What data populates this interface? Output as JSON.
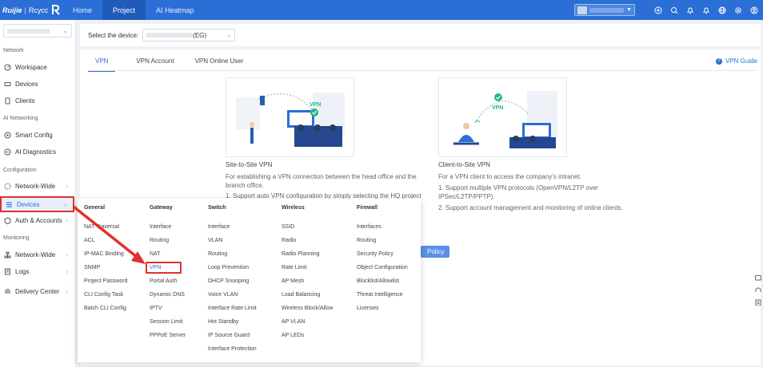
{
  "header": {
    "brand": "Ruijie",
    "brand_sub": "Rcycc",
    "nav": [
      "Home",
      "Project",
      "AI Heatmap"
    ],
    "active_nav": "Project"
  },
  "sidebar": {
    "sections": [
      {
        "title": "Network",
        "items": [
          "Workspace",
          "Devices",
          "Clients"
        ]
      },
      {
        "title": "AI Networking",
        "items": [
          "Smart Config",
          "AI Diagnostics"
        ]
      },
      {
        "title": "Configuration",
        "items": [
          "Network-Wide",
          "Devices",
          "Auth & Accounts"
        ]
      },
      {
        "title": "Monitoring",
        "items": [
          "Network-Wide",
          "Logs",
          "Delivery Center"
        ]
      }
    ]
  },
  "device_bar": {
    "label": "Select the device:",
    "selected_suffix": "(EG)"
  },
  "tabs": [
    "VPN",
    "VPN Account",
    "VPN Online User"
  ],
  "guide": "VPN Guide",
  "cards": {
    "s2s": {
      "title": "Site-to-Site VPN",
      "desc1": "For establishing a VPN connection between the head office and the",
      "desc2": "branch office.",
      "note": "1. Support auto VPN configuration by simply selecting the HQ project",
      "badge": "VPN"
    },
    "c2s": {
      "title": "Client-to-Site VPN",
      "desc1": "For a VPN client to access the company's intranet.",
      "note1": "1. Support multiple VPN protocols (OpenVPN/L2TP over",
      "note1b": "IPSec/L2TP/PPTP).",
      "note2": "2. Support account management and monitoring of online clients.",
      "badge": "VPN"
    }
  },
  "policy_button": "Policy",
  "menu": {
    "columns": [
      {
        "title": "General",
        "items": [
          "NAT Traversal",
          "ACL",
          "IP-MAC Binding",
          "SNMP",
          "Project Password",
          "CLI Config Task",
          "Batch CLI Config"
        ]
      },
      {
        "title": "Gateway",
        "items": [
          "Interface",
          "Routing",
          "NAT",
          "VPN",
          "Portal Auth",
          "Dynamic DNS",
          "IPTV",
          "Session Limit",
          "PPPoE Server"
        ]
      },
      {
        "title": "Switch",
        "items": [
          "Interface",
          "VLAN",
          "Routing",
          "Loop Prevention",
          "DHCP Snooping",
          "Voice VLAN",
          "Interface Rate Limit",
          "Hot Standby",
          "IP Source Guard",
          "Interface Protection"
        ]
      },
      {
        "title": "Wireless",
        "items": [
          "SSID",
          "Radio",
          "Radio Planning",
          "Rate Limit",
          "AP Mesh",
          "Load Balancing",
          "Wireless Block/Allow",
          "AP VLAN",
          "AP LEDs"
        ]
      },
      {
        "title": "Firewall",
        "items": [
          "Interfaces",
          "Routing",
          "Security Policy",
          "Object Configuration",
          "Blocklist/Allowlist",
          "Threat Intelligence",
          "Licenses"
        ]
      }
    ]
  },
  "colors": {
    "primary": "#2b6fd6",
    "highlight": "#e0322c",
    "success": "#1fb880"
  }
}
